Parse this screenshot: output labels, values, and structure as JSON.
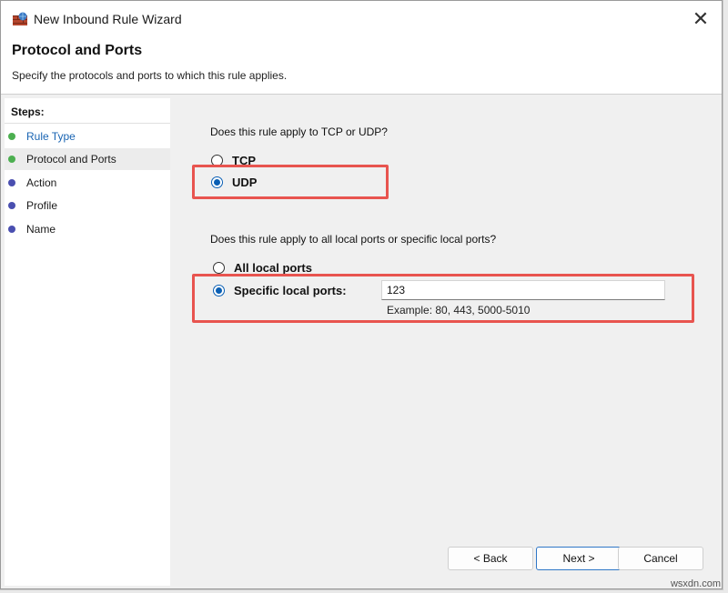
{
  "window": {
    "title": "New Inbound Rule Wizard",
    "close_glyph": "✕"
  },
  "header": {
    "title": "Protocol and Ports",
    "subtitle": "Specify the protocols and ports to which this rule applies."
  },
  "steps": {
    "title": "Steps:",
    "items": [
      {
        "label": "Rule Type",
        "state": "done",
        "color": "#1a65b3",
        "dot": "#4caf50"
      },
      {
        "label": "Protocol and Ports",
        "state": "current",
        "color": "#111111",
        "dot": "#4caf50"
      },
      {
        "label": "Action",
        "state": "pending",
        "color": "#111111",
        "dot": "#4a4fb0"
      },
      {
        "label": "Profile",
        "state": "pending",
        "color": "#111111",
        "dot": "#4a4fb0"
      },
      {
        "label": "Name",
        "state": "pending",
        "color": "#111111",
        "dot": "#4a4fb0"
      }
    ]
  },
  "protocol": {
    "question": "Does this rule apply to TCP or UDP?",
    "options": [
      {
        "label": "TCP",
        "checked": false
      },
      {
        "label": "UDP",
        "checked": true
      }
    ]
  },
  "ports": {
    "question": "Does this rule apply to all local ports or specific local ports?",
    "options": [
      {
        "label": "All local ports",
        "checked": false
      },
      {
        "label": "Specific local ports:",
        "checked": true
      }
    ],
    "value": "123",
    "example": "Example: 80, 443, 5000-5010"
  },
  "buttons": {
    "back": "< Back",
    "next": "Next >",
    "cancel": "Cancel"
  },
  "watermark": "wsxdn.com",
  "colors": {
    "highlight": "#e8544f",
    "accent": "#0a5fb4"
  }
}
